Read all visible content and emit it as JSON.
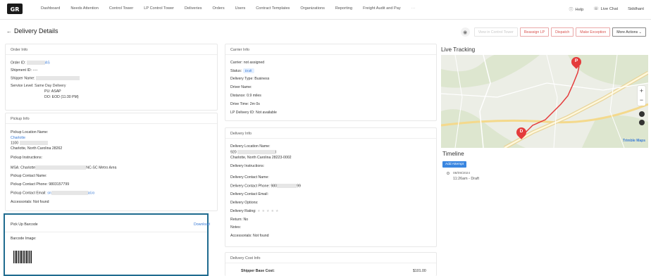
{
  "nav": {
    "items": [
      "Dashboard",
      "Needs Attention",
      "Control Tower",
      "LP Control Tower",
      "Deliveries",
      "Orders",
      "Users",
      "Contract Templates",
      "Organizations",
      "Reporting",
      "Freight Audit and Pay",
      "···"
    ],
    "help": "Help",
    "live_chat": "Live Chat",
    "user": "Siddhant"
  },
  "header": {
    "back": "←",
    "title": "Delivery Details",
    "buttons": {
      "view_control_tower": "View in Control Tower",
      "reassign_lp": "Reassign LP",
      "dispatch": "Dispatch",
      "make_exception": "Make Exception",
      "more_actions": "More Actions ⌄"
    }
  },
  "order_info": {
    "title": "Order Info",
    "order_id_label": "Order ID:",
    "order_id_suffix": "AS",
    "shipment_id_label": "Shipment ID:",
    "shipment_id": "----",
    "shipper_name_label": "Shipper Name:",
    "service_level_label": "Service Level:",
    "service_level": "Same Day Delivery",
    "pu": "PU: ASAP",
    "do": "DO: EOD (11:30 PM)"
  },
  "pickup_info": {
    "title": "Pickup Info",
    "location_name_label": "Pickup Location Name:",
    "location_name": "Charlotte",
    "address1": "1100",
    "address2": "Charlotte, North Carolina 28262",
    "instructions_label": "Pickup Instructions:",
    "msa_label": "MSA:",
    "msa_prefix": "Charlotte",
    "msa_suffix": "NC-SC Metro Area",
    "contact_name_label": "Pickup Contact Name:",
    "contact_phone_label": "Pickup Contact Phone:",
    "contact_phone": "9803157799",
    "contact_email_label": "Pickup Contact Email:",
    "contact_email_prefix": "sn",
    "contact_email_suffix": "al.io",
    "accessorials_label": "Accessorials:",
    "accessorials": "Not found"
  },
  "barcode": {
    "title": "Pick Up Barcode",
    "download": "Download",
    "image_label": "Barcode Image:"
  },
  "carrier_info": {
    "title": "Carrier Info",
    "carrier_label": "Carrier:",
    "carrier": "not assigned",
    "status_label": "Status:",
    "status": "Draft",
    "delivery_type_label": "Delivery Type:",
    "delivery_type": "Business",
    "driver_name_label": "Driver Name:",
    "distance_label": "Distance:",
    "distance": "0.9 miles",
    "drive_time_label": "Drive Time:",
    "drive_time": "2m 0s",
    "lp_delivery_id_label": "LP Delivery ID:",
    "lp_delivery_id": "Not available"
  },
  "delivery_info": {
    "title": "Delivery Info",
    "location_name_label": "Delivery Location Name:",
    "address1": "920",
    "address1_suffix": "l",
    "address2": "Charlotte, North Carolina 28223-0002",
    "instructions_label": "Delivery Instructions:",
    "contact_name_label": "Delivery Contact Name:",
    "contact_phone_label": "Delivery Contact Phone:",
    "contact_phone_prefix": "980",
    "contact_phone_suffix": "99",
    "contact_email_label": "Delivery Contact Email:",
    "options_label": "Delivery Options:",
    "rating_label": "Delivery Rating:",
    "rating_stars": "★★★★★",
    "return_label": "Return:",
    "return": "No",
    "notes_label": "Notes:",
    "accessorials_label": "Accessorials:",
    "accessorials": "Not found"
  },
  "delivery_cost": {
    "title": "Delivery Cost Info",
    "shipper_base_cost_label": "Shipper Base Cost:",
    "shipper_base_cost": "$101.00"
  },
  "tracking": {
    "title": "Live Tracking",
    "pickup_marker": "P",
    "dropoff_marker": "D",
    "map_credit": "Trimble Maps",
    "zoom_in": "+",
    "zoom_out": "−"
  },
  "timeline": {
    "title": "Timeline",
    "add_attempt": "Add Attempt",
    "date": "08/09/2024",
    "entry": "11:26am - Draft"
  }
}
